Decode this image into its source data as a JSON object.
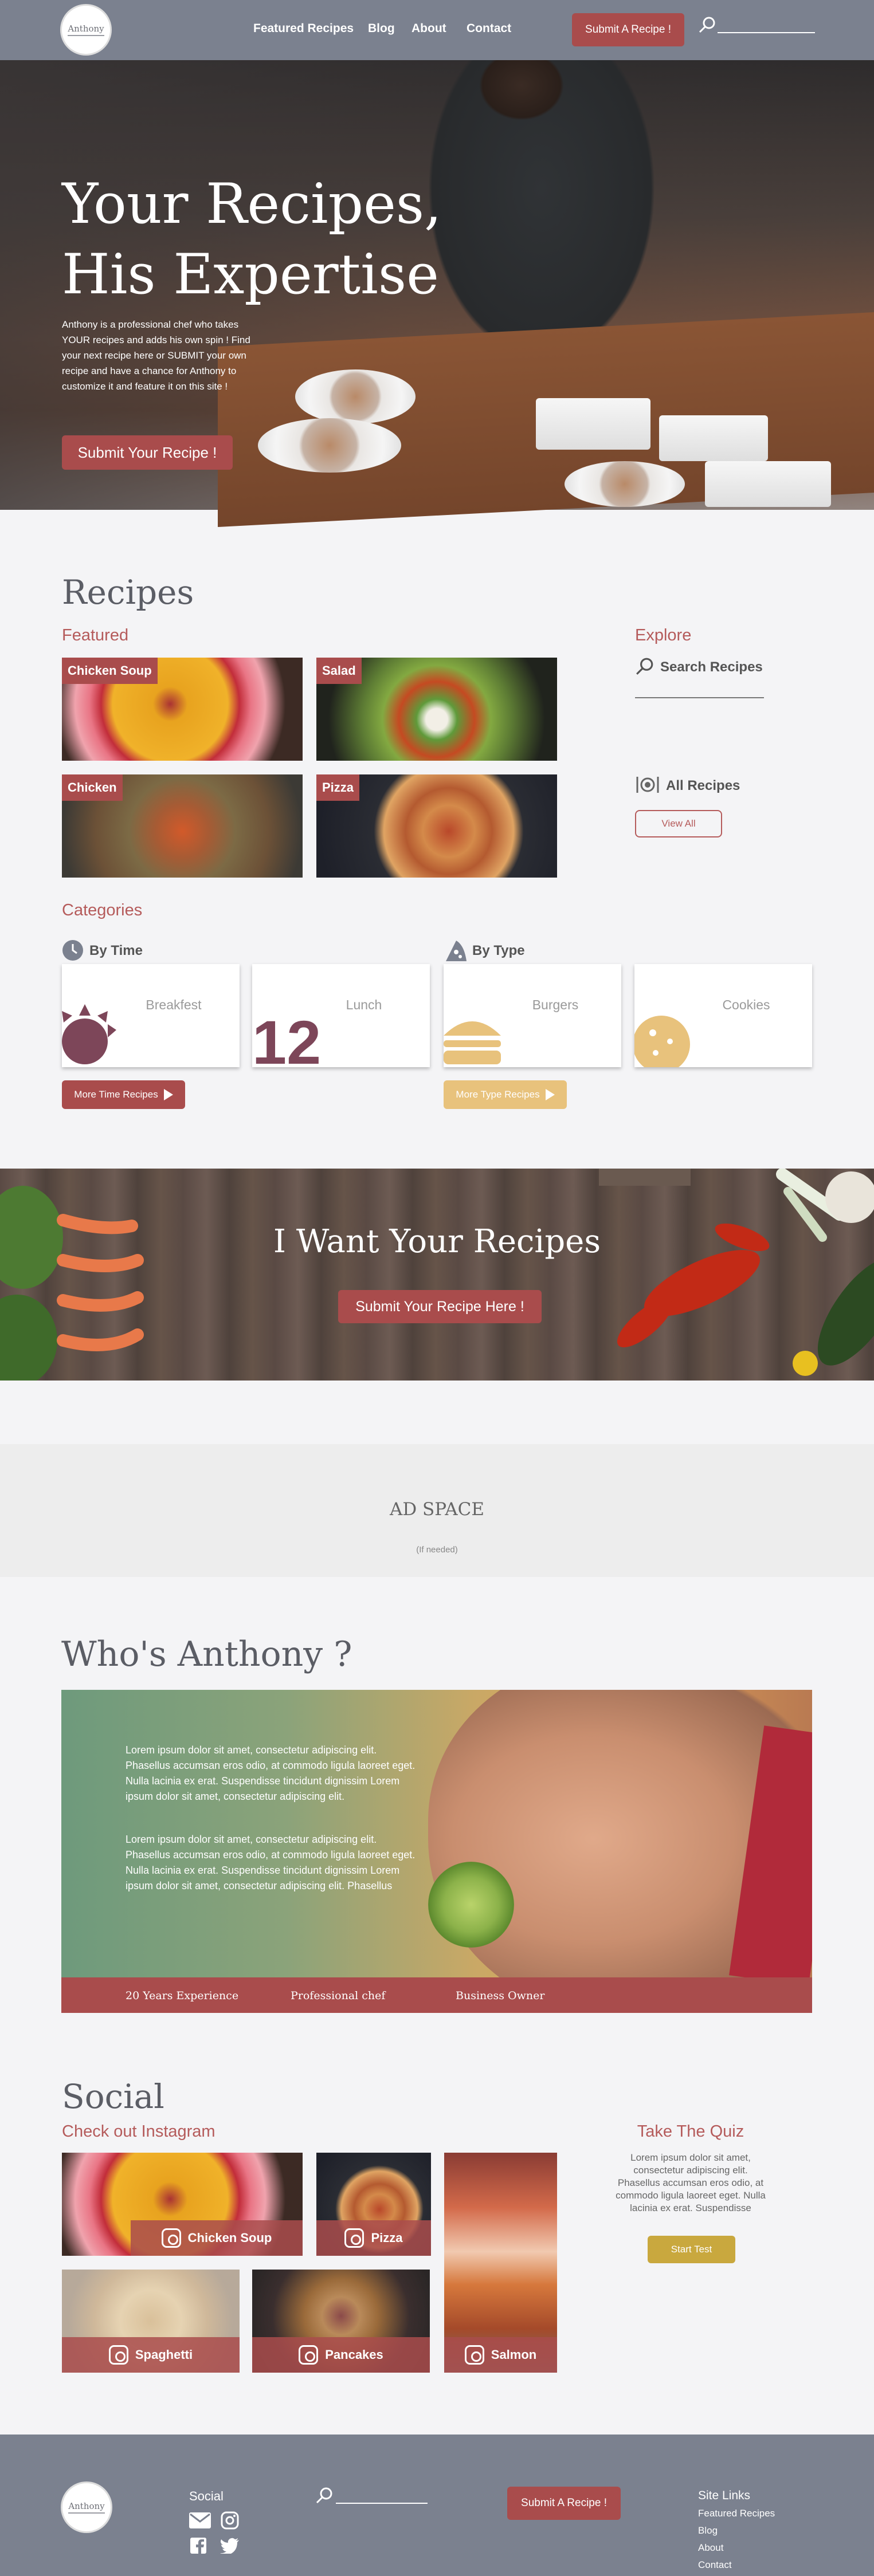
{
  "nav": {
    "logo": "Anthony",
    "links": [
      "Featured Recipes",
      "Blog",
      "About",
      "Contact"
    ],
    "submit_button": "Submit A Recipe !"
  },
  "hero": {
    "title_line1": "Your Recipes,",
    "title_line2": "His Expertise",
    "description": "Anthony is a professional chef who takes YOUR recipes and adds his own spin ! Find your next recipe here or SUBMIT your own recipe and have a chance for Anthony to customize it and feature it on this site !",
    "button": "Submit Your Recipe !"
  },
  "recipes": {
    "title": "Recipes",
    "featured_heading": "Featured",
    "featured": [
      {
        "label": "Chicken Soup"
      },
      {
        "label": "Salad"
      },
      {
        "label": "Chicken"
      },
      {
        "label": "Pizza"
      }
    ],
    "explore_heading": "Explore",
    "search_label": "Search Recipes",
    "all_recipes_label": "All Recipes",
    "view_all_button": "View All",
    "categories_heading": "Categories",
    "by_time": "By Time",
    "by_type": "By Type",
    "category_cards": [
      "Breakfest",
      "Lunch",
      "Burgers",
      "Cookies"
    ],
    "lunch_number": "12",
    "more_time_button": "More Time Recipes",
    "more_type_button": "More Type Recipes"
  },
  "banner": {
    "title": "I Want Your Recipes",
    "button": "Submit Your Recipe Here !"
  },
  "ad": {
    "title": "AD SPACE",
    "subtitle": "(If needed)"
  },
  "who": {
    "title": "Who's Anthony ?",
    "para1": "Lorem ipsum dolor sit amet, consectetur adipiscing elit. Phasellus accumsan eros odio, at commodo ligula laoreet eget. Nulla lacinia ex erat. Suspendisse tincidunt dignissim Lorem ipsum dolor sit amet, consectetur adipiscing elit.",
    "para2": "Lorem ipsum dolor sit amet, consectetur adipiscing elit. Phasellus accumsan eros odio, at commodo ligula laoreet eget. Nulla lacinia ex erat. Suspendisse tincidunt dignissim Lorem ipsum dolor sit amet, consectetur adipiscing elit. Phasellus",
    "facts": [
      "20 Years Experience",
      "Professional chef",
      "Business Owner"
    ]
  },
  "social": {
    "title": "Social",
    "instagram_heading": "Check out Instagram",
    "posts": [
      "Chicken Soup",
      "Pizza",
      "Spaghetti",
      "Pancakes",
      "Salmon"
    ],
    "quiz_heading": "Take The Quiz",
    "quiz_text": "Lorem ipsum dolor sit amet, consectetur adipiscing elit. Phasellus accumsan eros odio, at commodo ligula laoreet eget. Nulla lacinia ex erat. Suspendisse",
    "quiz_button": "Start Test"
  },
  "footer": {
    "logo": "Anthony",
    "social_heading": "Social",
    "submit_button": "Submit A Recipe !",
    "site_links_heading": "Site Links",
    "site_links": [
      "Featured Recipes",
      "Blog",
      "About",
      "Contact"
    ]
  },
  "colors": {
    "nav_bg": "#7b818f",
    "accent_red": "#a94c4c",
    "accent_yellow": "#e8c27c",
    "quiz_button": "#c9a83e",
    "page_bg": "#f4f4f6"
  }
}
